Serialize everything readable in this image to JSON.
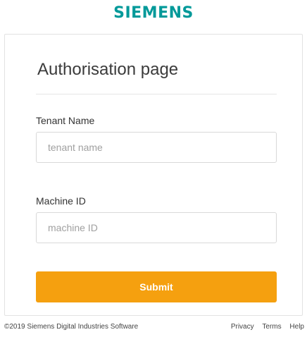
{
  "brand": {
    "logo_text": "SIEMENS",
    "logo_color": "#009999"
  },
  "card": {
    "title": "Authorisation page"
  },
  "form": {
    "tenant": {
      "label": "Tenant Name",
      "placeholder": "tenant name",
      "value": ""
    },
    "machine": {
      "label": "Machine ID",
      "placeholder": "machine ID",
      "value": ""
    },
    "submit_label": "Submit",
    "submit_color": "#f5a00f"
  },
  "footer": {
    "copyright": "©2019 Siemens Digital Industries Software",
    "links": [
      "Privacy",
      "Terms",
      "Help"
    ]
  }
}
